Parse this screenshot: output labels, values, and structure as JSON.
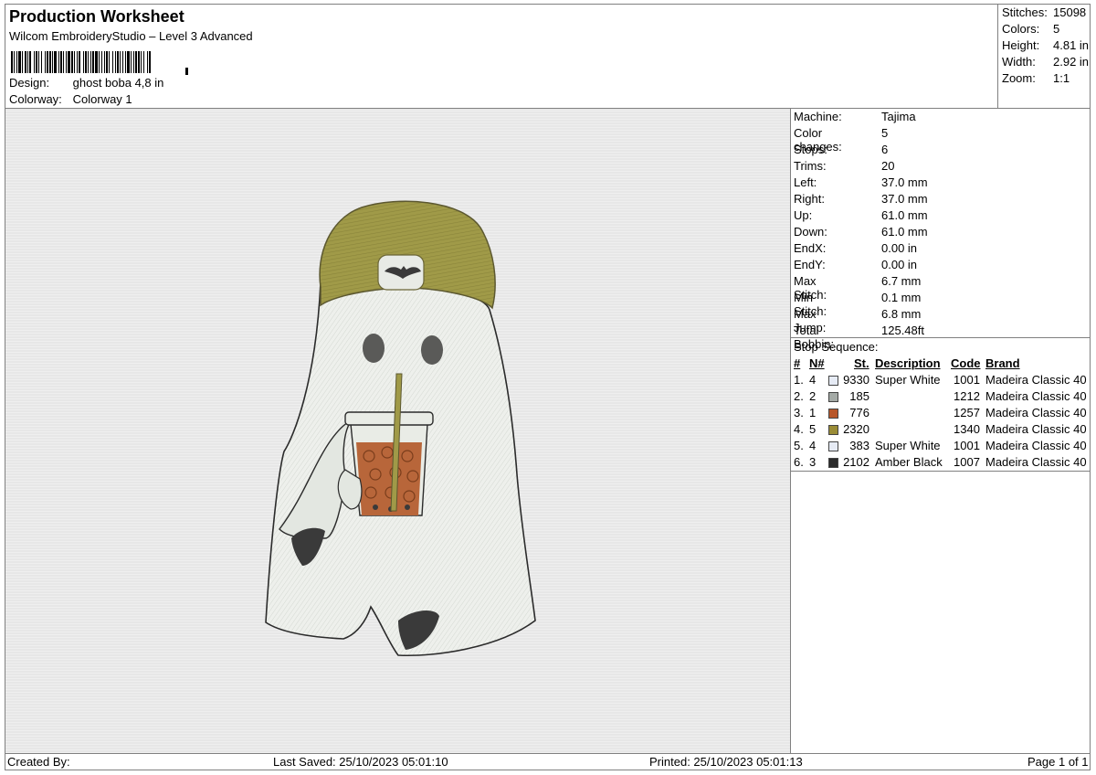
{
  "header": {
    "title": "Production Worksheet",
    "software": "Wilcom EmbroideryStudio – Level 3 Advanced",
    "design_label": "Design:",
    "design": "ghost boba 4,8 in",
    "colorway_label": "Colorway:",
    "colorway": "Colorway 1"
  },
  "summary": [
    {
      "label": "Stitches:",
      "value": "15098"
    },
    {
      "label": "Colors:",
      "value": "5"
    },
    {
      "label": "Height:",
      "value": "4.81 in"
    },
    {
      "label": "Width:",
      "value": "2.92 in"
    },
    {
      "label": "Zoom:",
      "value": "1:1"
    }
  ],
  "machine_info": [
    {
      "label": "Machine:",
      "value": "Tajima"
    },
    {
      "label": "Color changes:",
      "value": "5"
    },
    {
      "label": "Stops:",
      "value": "6"
    },
    {
      "label": "Trims:",
      "value": "20"
    },
    {
      "label": "Left:",
      "value": "37.0 mm"
    },
    {
      "label": "Right:",
      "value": "37.0 mm"
    },
    {
      "label": "Up:",
      "value": "61.0 mm"
    },
    {
      "label": "Down:",
      "value": "61.0 mm"
    },
    {
      "label": "EndX:",
      "value": "0.00 in"
    },
    {
      "label": "EndY:",
      "value": "0.00 in"
    },
    {
      "label": "Max Stitch:",
      "value": "6.7 mm"
    },
    {
      "label": "Min Stitch:",
      "value": "0.1 mm"
    },
    {
      "label": "Max Jump:",
      "value": "6.8 mm"
    },
    {
      "label": "Total Bobbin:",
      "value": "125.48ft"
    }
  ],
  "stop_sequence": {
    "title": "Stop Sequence:",
    "headers": {
      "num": "#",
      "n": "N#",
      "st": "St.",
      "description": "Description",
      "code": "Code",
      "brand": "Brand"
    },
    "rows": [
      {
        "num": "1.",
        "n": "4",
        "color": "#e6ebf5",
        "st": "9330",
        "description": "Super White",
        "code": "1001",
        "brand": "Madeira Classic 40"
      },
      {
        "num": "2.",
        "n": "2",
        "color": "#a4aaa6",
        "st": "185",
        "description": "",
        "code": "1212",
        "brand": "Madeira Classic 40"
      },
      {
        "num": "3.",
        "n": "1",
        "color": "#b8572a",
        "st": "776",
        "description": "",
        "code": "1257",
        "brand": "Madeira Classic 40"
      },
      {
        "num": "4.",
        "n": "5",
        "color": "#9a8c36",
        "st": "2320",
        "description": "",
        "code": "1340",
        "brand": "Madeira Classic 40"
      },
      {
        "num": "5.",
        "n": "4",
        "color": "#e6ebf5",
        "st": "383",
        "description": "Super White",
        "code": "1001",
        "brand": "Madeira Classic 40"
      },
      {
        "num": "6.",
        "n": "3",
        "color": "#2a2a2a",
        "st": "2102",
        "description": "Amber Black",
        "code": "1007",
        "brand": "Madeira Classic 40"
      }
    ]
  },
  "footer": {
    "created_by": "Created By:",
    "last_saved": "Last Saved: 25/10/2023 05:01:10",
    "printed": "Printed: 25/10/2023 05:01:13",
    "page": "Page 1 of 1"
  },
  "colors": {
    "hat": "#a09a48",
    "ghost": "#eef0ec",
    "drink": "#b8663a",
    "dark": "#3a3a3a"
  }
}
